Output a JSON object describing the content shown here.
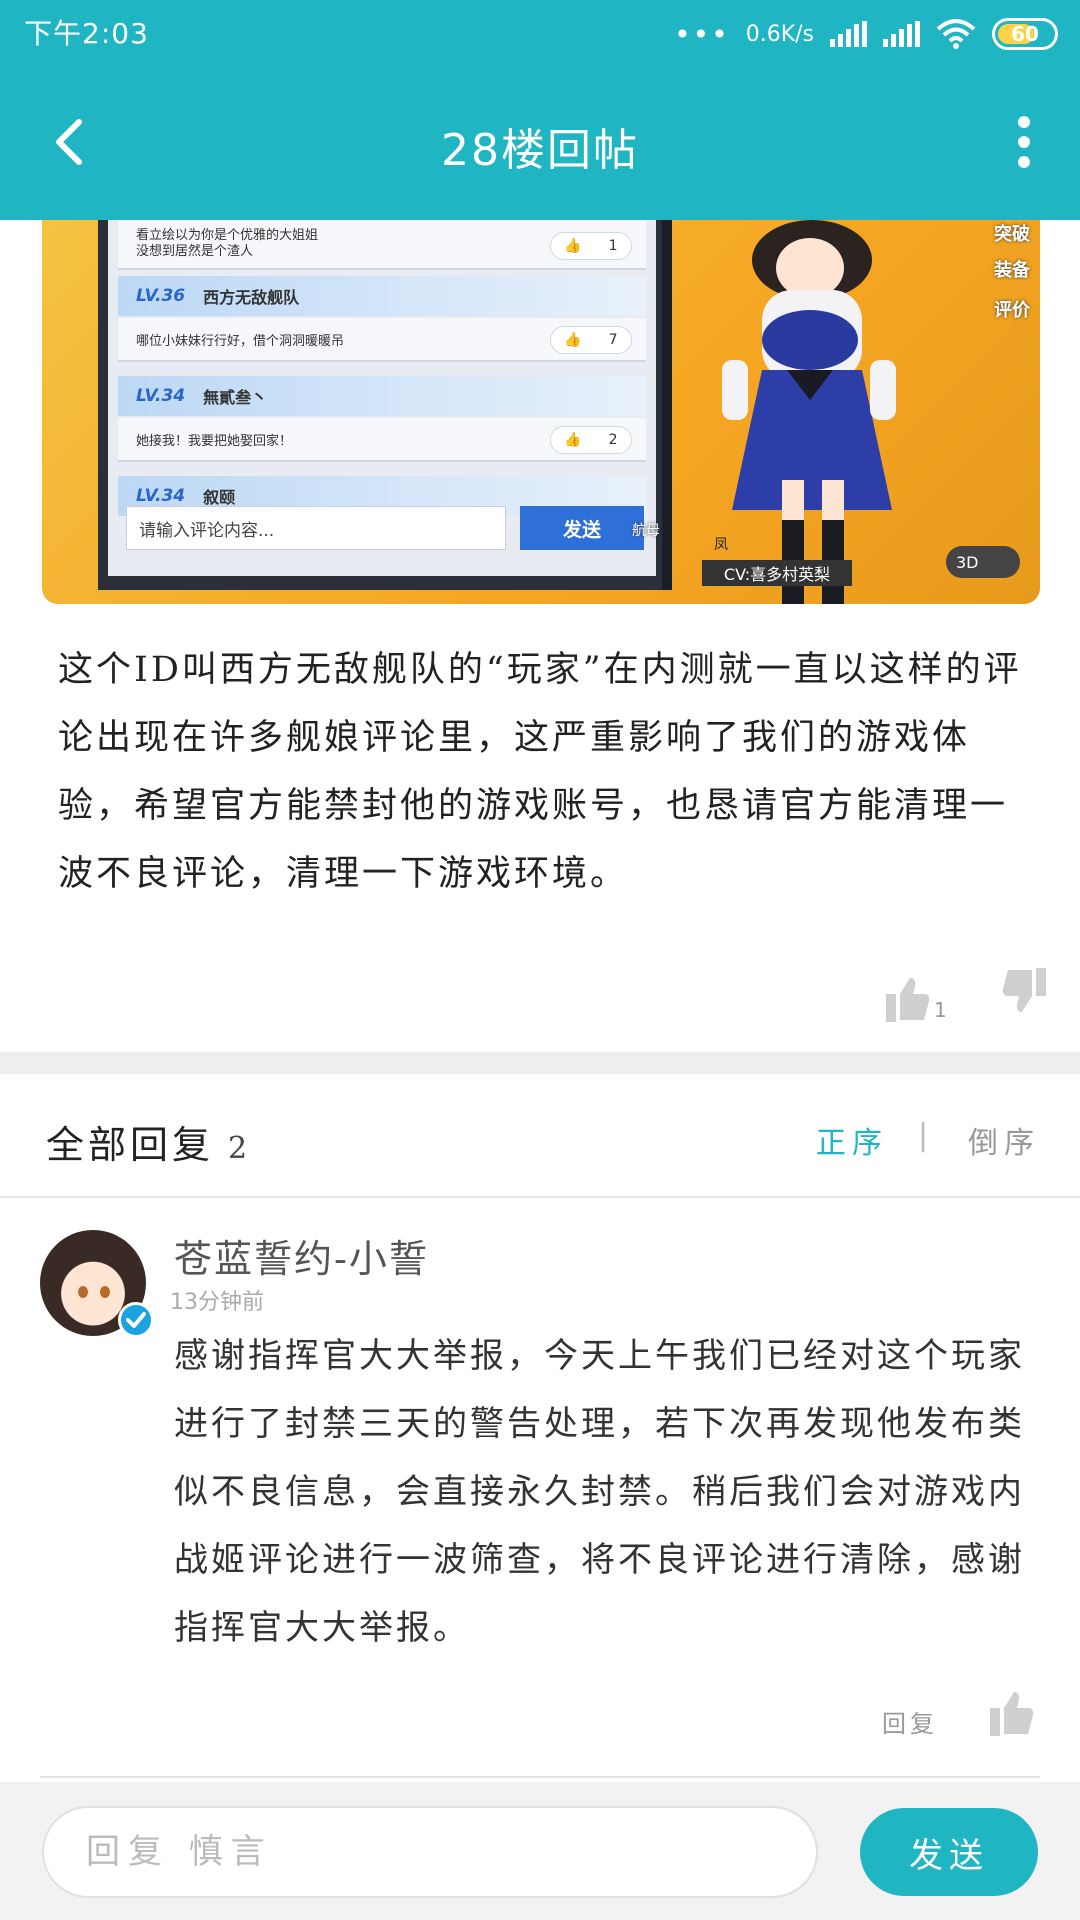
{
  "status_bar": {
    "time": "下午2:03",
    "network_speed": "0.6K/s",
    "battery_level": "60",
    "icons": [
      "more-dots-icon",
      "signal-icon",
      "signal-icon",
      "wifi-icon",
      "battery-icon"
    ],
    "battery_color": "#ffd24a"
  },
  "top_bar": {
    "title": "28楼回帖",
    "back_icon": "chevron-left-icon",
    "more_icon": "more-vertical-icon",
    "color": "#1fb5c2"
  },
  "post_image": {
    "comments": [
      {
        "text": "看立绘以为你是个优雅的大姐姐\n没想到居然是个渣人",
        "likes": "1"
      },
      {
        "level": "LV.36",
        "user": "西方无敌舰队",
        "text": "哪位小妹妹行行好，借个洞洞暖暖吊",
        "likes": "7"
      },
      {
        "level": "LV.34",
        "user": "無貳叁丶",
        "text": "她接我！我要把她娶回家！",
        "likes": "2"
      },
      {
        "level": "LV.34",
        "user": "叙颐"
      }
    ],
    "input_placeholder": "请输入评论内容...",
    "send_label": "发送",
    "side_labels": [
      "突破",
      "装备",
      "评价"
    ],
    "ship_type": "航母",
    "ship_name": "凤",
    "cv": "CV:喜多村英梨",
    "toggle_label": "3D"
  },
  "post": {
    "body": "这个ID叫西方无敌舰队的“玩家”在内测就一直以这样的评论出现在许多舰娘评论里，这严重影响了我们的游戏体验，希望官方能禁封他的游戏账号，也恳请官方能清理一波不良评论，清理一下游戏环境。",
    "like_count": "1",
    "like_icon": "thumbs-up-icon",
    "dislike_icon": "thumbs-down-icon"
  },
  "replies": {
    "title": "全部回复",
    "count": "2",
    "sort_asc": "正序",
    "sort_desc": "倒序",
    "accent": "#1fb5c2",
    "items": [
      {
        "author": "苍蓝誓约-小誓",
        "time": "13分钟前",
        "text": "感谢指挥官大大举报，今天上午我们已经对这个玩家进行了封禁三天的警告处理，若下次再发现他发布类似不良信息，会直接永久封禁。稍后我们会对游戏内战姬评论进行一波筛查，将不良评论进行清除，感谢指挥官大大举报。",
        "reply_label": "回复",
        "avatar_icon": "avatar",
        "verified_icon": "verified-check-icon"
      }
    ]
  },
  "composer": {
    "placeholder": "回复 慎言",
    "send_label": "发送"
  }
}
